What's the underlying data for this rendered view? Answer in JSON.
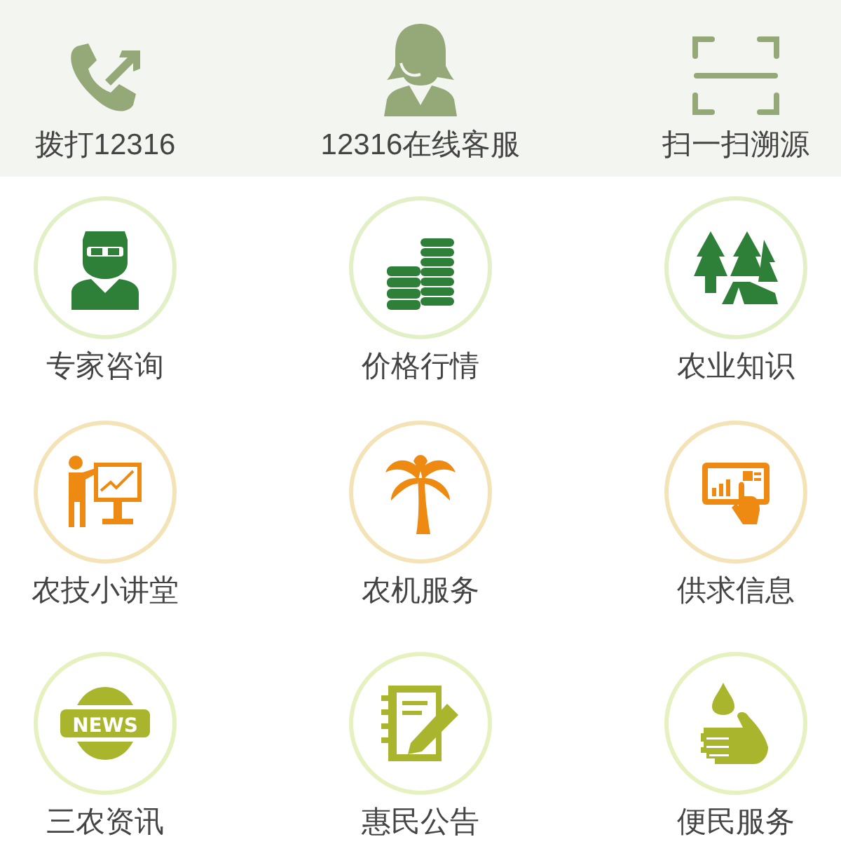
{
  "top_actions": [
    {
      "kind": "phone",
      "label": "拨打12316"
    },
    {
      "kind": "agent",
      "label": "12316在线客服"
    },
    {
      "kind": "scan",
      "label": "扫一扫溯源"
    }
  ],
  "services": [
    {
      "kind": "expert",
      "label": "专家咨询",
      "color": "#2e8038"
    },
    {
      "kind": "coins",
      "label": "价格行情",
      "color": "#2e8038"
    },
    {
      "kind": "trees",
      "label": "农业知识",
      "color": "#2e8038"
    },
    {
      "kind": "lecture",
      "label": "农技小讲堂",
      "color": "#ee8a12"
    },
    {
      "kind": "palm",
      "label": "农机服务",
      "color": "#ee8a12"
    },
    {
      "kind": "tablet",
      "label": "供求信息",
      "color": "#ee8a12"
    },
    {
      "kind": "news",
      "label": "三农资讯",
      "color": "#a9b52c",
      "icon_text": "NEWS"
    },
    {
      "kind": "notebook",
      "label": "惠民公告",
      "color": "#a9b52c"
    },
    {
      "kind": "hand",
      "label": "便民服务",
      "color": "#a9b52c"
    }
  ]
}
